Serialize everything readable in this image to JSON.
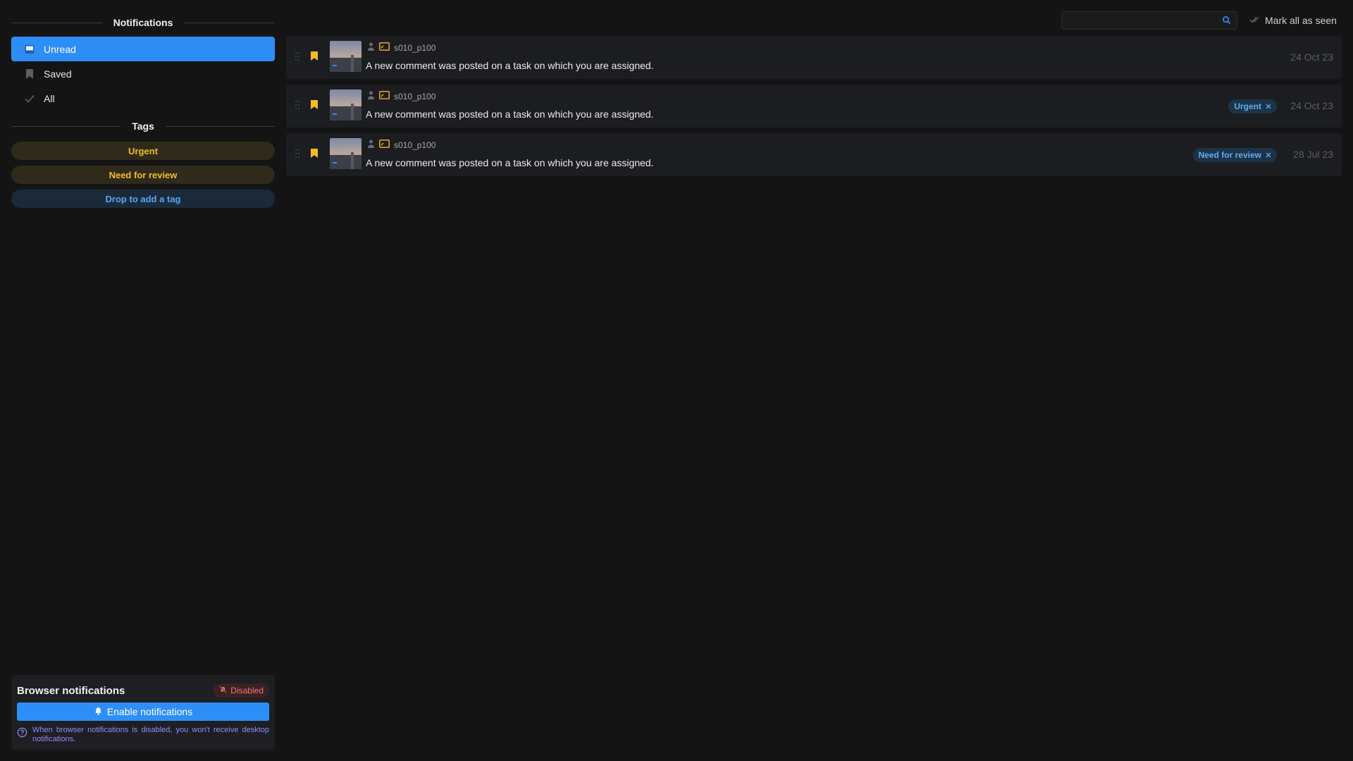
{
  "sidebar": {
    "title": "Notifications",
    "items": [
      {
        "label": "Unread",
        "icon": "inbox-icon",
        "active": true
      },
      {
        "label": "Saved",
        "icon": "bookmark-icon",
        "active": false
      },
      {
        "label": "All",
        "icon": "check-icon",
        "active": false
      }
    ],
    "tags_title": "Tags",
    "tags": [
      "Urgent",
      "Need for review"
    ],
    "drop_label": "Drop to add a tag"
  },
  "browser_notifications": {
    "title": "Browser notifications",
    "status": "Disabled",
    "enable_label": "Enable notifications",
    "help": "When browser notifications is disabled, you won't receive desktop notifications."
  },
  "topbar": {
    "search_value": "",
    "mark_all_label": "Mark all as seen"
  },
  "notifications": [
    {
      "entity": "s010_p100",
      "message": "A new comment was posted on a task on which you are assigned.",
      "tag": "",
      "date": "24 Oct 23"
    },
    {
      "entity": "s010_p100",
      "message": "A new comment was posted on a task on which you are assigned.",
      "tag": "Urgent",
      "date": "24 Oct 23"
    },
    {
      "entity": "s010_p100",
      "message": "A new comment was posted on a task on which you are assigned.",
      "tag": "Need for review",
      "date": "28 Jul 23"
    }
  ],
  "colors": {
    "accent": "#2e8ef7",
    "tag_yellow": "#f2bb2c",
    "tag_blue": "#5eaef5",
    "disabled_red": "#f07777"
  }
}
